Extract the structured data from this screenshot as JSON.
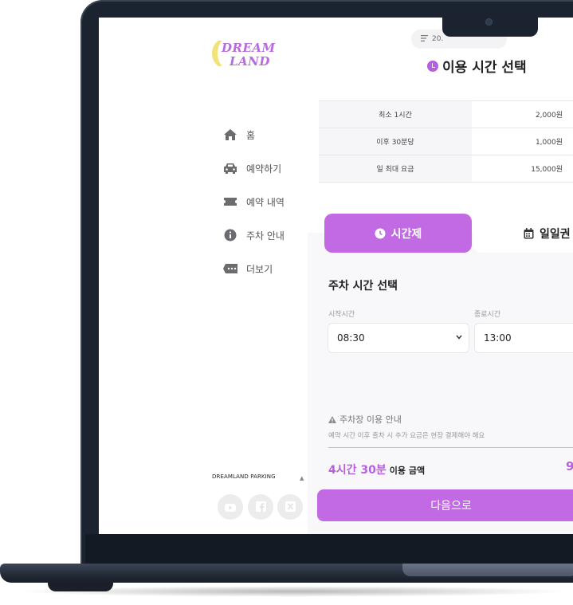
{
  "logo": {
    "line1": "DREAM",
    "line2": "LAND"
  },
  "sidebar": {
    "items": [
      {
        "icon": "home-icon",
        "label": "홈"
      },
      {
        "icon": "car-icon",
        "label": "예약하기"
      },
      {
        "icon": "ticket-icon",
        "label": "예약 내역"
      },
      {
        "icon": "info-icon",
        "label": "주차 안내"
      },
      {
        "icon": "more-icon",
        "label": "더보기"
      }
    ],
    "brand": "DREAMLAND PARKING",
    "social": [
      "youtube-icon",
      "facebook-icon",
      "x-icon"
    ]
  },
  "header": {
    "date_chip": "20.",
    "title": "이용 시간 선택"
  },
  "fees": [
    {
      "label": "최소 1시간",
      "value": "2,000원"
    },
    {
      "label": "이후 30분당",
      "value": "1,000원"
    },
    {
      "label": "일 최대 요금",
      "value": "15,000원"
    }
  ],
  "tabs": {
    "hourly": "시간제",
    "daily": "일일권",
    "active": "hourly"
  },
  "form": {
    "section_title": "주차 시간 선택",
    "start_label": "시작시간",
    "start_value": "08:30",
    "end_label": "종료시간",
    "end_value": "13:00"
  },
  "notice": {
    "title": "주차장 이용 안내",
    "text": "예약 시간 이후 출차 시 추가 요금은 현장 결제해야 해요"
  },
  "summary": {
    "duration": "4시간 30분",
    "label": "이용 금액",
    "amount_partial": "9"
  },
  "next_button": "다음으로",
  "colors": {
    "accent": "#c26ae3",
    "accent_text": "#b660dd",
    "logo_moon": "#f3e27a",
    "frame": "#1c2330"
  }
}
